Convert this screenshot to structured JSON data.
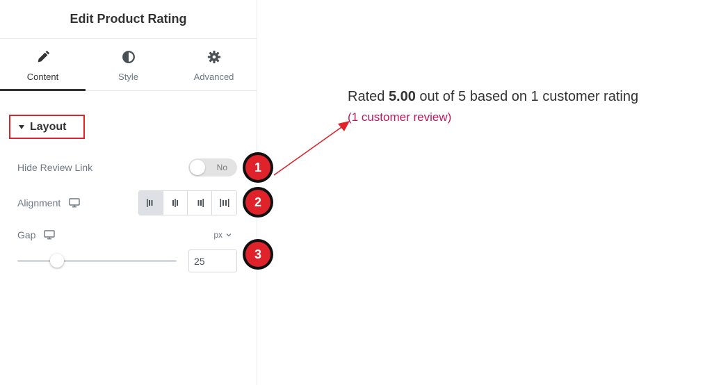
{
  "panel": {
    "title": "Edit Product Rating",
    "tabs": [
      {
        "label": "Content",
        "icon": "pencil-icon",
        "active": true
      },
      {
        "label": "Style",
        "icon": "half-circle-icon",
        "active": false
      },
      {
        "label": "Advanced",
        "icon": "gear-icon",
        "active": false
      }
    ],
    "section": {
      "title": "Layout",
      "hide_review_link": {
        "label": "Hide Review Link",
        "toggle_text": "No",
        "value": false
      },
      "alignment": {
        "label": "Alignment",
        "device_icon": "monitor-icon",
        "options": [
          "align-left-icon",
          "align-center-icon",
          "align-right-icon",
          "align-justify-icon"
        ],
        "selected": 0
      },
      "gap": {
        "label": "Gap",
        "device_icon": "monitor-icon",
        "unit": "px",
        "value": "25",
        "slider_fraction": 0.25
      }
    }
  },
  "badges": [
    "1",
    "2",
    "3"
  ],
  "preview": {
    "rating_prefix": "Rated ",
    "rating_value": "5.00",
    "rating_suffix": " out of 5 based on 1 customer rating",
    "review_link": "(1 customer review)"
  },
  "colors": {
    "accent_red": "#e0232b",
    "link": "#c2185b"
  }
}
